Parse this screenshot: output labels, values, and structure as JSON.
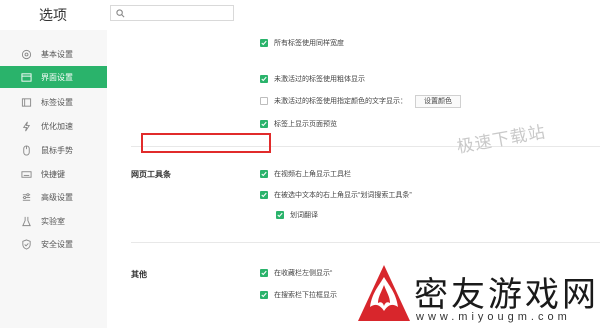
{
  "header": {
    "title": "选项",
    "search_placeholder": ""
  },
  "sidebar": {
    "items": [
      {
        "label": "基本设置",
        "icon": "gear-icon",
        "active": false
      },
      {
        "label": "界面设置",
        "icon": "window-icon",
        "active": true
      },
      {
        "label": "标签设置",
        "icon": "tab-icon",
        "active": false
      },
      {
        "label": "优化加速",
        "icon": "bolt-icon",
        "active": false
      },
      {
        "label": "鼠标手势",
        "icon": "mouse-icon",
        "active": false
      },
      {
        "label": "快捷键",
        "icon": "keyboard-icon",
        "active": false
      },
      {
        "label": "高级设置",
        "icon": "sliders-icon",
        "active": false
      },
      {
        "label": "实验室",
        "icon": "lab-icon",
        "active": false
      },
      {
        "label": "安全设置",
        "icon": "shield-icon",
        "active": false
      }
    ]
  },
  "tab_options": [
    {
      "label": "所有标签使用同样宽度",
      "checked": true
    },
    {
      "label": "未激活过的标签使用粗体显示",
      "checked": true
    },
    {
      "label": "未激活过的标签使用指定颜色的文字显示：",
      "checked": false,
      "button": "设置颜色"
    },
    {
      "label": "标签上显示页面预览",
      "checked": true
    }
  ],
  "webpage_tools": {
    "label": "网页工具条",
    "options": [
      {
        "label": "在视频右上角显示工具栏",
        "checked": true
      },
      {
        "label": "在被选中文本的右上角显示“划词搜索工具条”",
        "checked": true
      },
      {
        "label": "划词翻译",
        "checked": true
      }
    ]
  },
  "other": {
    "label": "其他",
    "options": [
      {
        "label": "在收藏栏左侧显示“",
        "checked": true
      },
      {
        "label": "在搜索栏下拉框显示",
        "checked": true
      }
    ]
  },
  "watermarks": {
    "text1": "极速下载站",
    "site_name": "密友游戏网",
    "site_url": "www.miyougm.com"
  },
  "colors": {
    "accent": "#2ab36b",
    "highlight": "#e12b2b",
    "logo_red": "#d8262c"
  }
}
